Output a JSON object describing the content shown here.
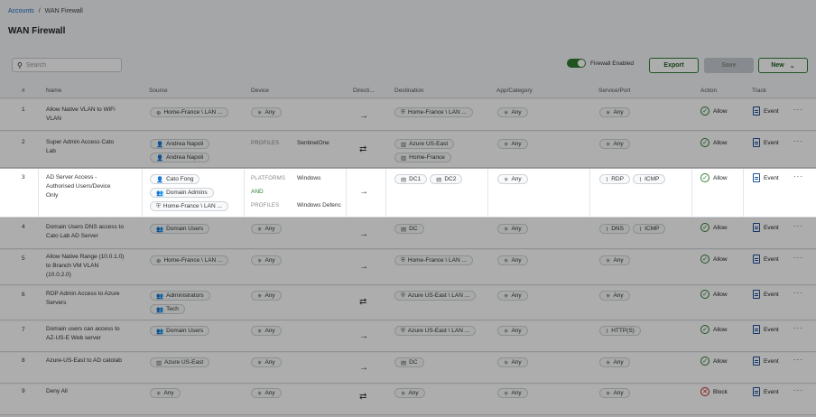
{
  "breadcrumb": {
    "root": "Accounts",
    "sep": "/",
    "current": "WAN Firewall"
  },
  "page_title": "WAN Firewall",
  "search": {
    "placeholder": "Search"
  },
  "toolbar": {
    "firewall_label": "Firewall Enabled",
    "export": "Export",
    "save": "Save",
    "new": "New"
  },
  "columns": [
    "#",
    "Name",
    "Source",
    "Device",
    "Directi...",
    "Destination",
    "App/Category",
    "Service/Port",
    "Action",
    "Track"
  ],
  "rules": [
    {
      "num": "1",
      "name": [
        "Allow Native VLAN to WiFi",
        "VLAN"
      ],
      "source": [
        "Home-France \\ LAN ..."
      ],
      "device": [
        "Any"
      ],
      "direction": "→",
      "destination": [
        "Home-France \\ LAN ..."
      ],
      "app": "Any",
      "service": [
        "Any"
      ],
      "action": "Allow",
      "track": "Event"
    },
    {
      "num": "2",
      "name": [
        "Super Admin Access Cato",
        "Lab"
      ],
      "source": [
        "Andrea Napoli",
        "Andrea Napoli"
      ],
      "device_profiles": "PROFILES",
      "device_value": "SentinelOne",
      "direction": "⇄",
      "destination": [
        "Azure US-East",
        "Home-France"
      ],
      "app": "Any",
      "service": [
        "Any"
      ],
      "action": "Allow",
      "track": "Event"
    },
    {
      "num": "3",
      "name": [
        "AD Server Access -",
        "Authorised Users/Device",
        "Only"
      ],
      "source": [
        "Cato Fong",
        "Domain Admins",
        "Home-France \\ LAN ..."
      ],
      "device_platforms": "PLATFORMS",
      "device_platforms_value": "Windows",
      "device_and": "AND",
      "device_profiles": "PROFILES",
      "device_profiles_value": "Windows Defenc",
      "direction": "→",
      "destination": [
        "DC1",
        "DC2"
      ],
      "app": "Any",
      "service": [
        "RDP",
        "ICMP"
      ],
      "action": "Allow",
      "track": "Event"
    },
    {
      "num": "4",
      "name": [
        "Domain Users DNS access to",
        "Cato Lab AD Server"
      ],
      "source": [
        "Domain Users"
      ],
      "device": [
        "Any"
      ],
      "direction": "→",
      "destination": [
        "DC"
      ],
      "app": "Any",
      "service": [
        "DNS",
        "ICMP"
      ],
      "action": "Allow",
      "track": "Event"
    },
    {
      "num": "5",
      "name": [
        "Allow Native Range (10.0.1.0)",
        "to Branch VM VLAN",
        "(10.0.2.0)"
      ],
      "source": [
        "Home-France \\ LAN ..."
      ],
      "device": [
        "Any"
      ],
      "direction": "→",
      "destination": [
        "Home-France \\ LAN ..."
      ],
      "app": "Any",
      "service": [
        "Any"
      ],
      "action": "Allow",
      "track": "Event"
    },
    {
      "num": "6",
      "name": [
        "RDP Admin Access to Azure",
        "Servers"
      ],
      "source": [
        "Administrators",
        "Tech"
      ],
      "device": [
        "Any"
      ],
      "direction": "⇄",
      "destination": [
        "Azure US-East \\ LAN ..."
      ],
      "app": "Any",
      "service": [
        "Any"
      ],
      "action": "Allow",
      "track": "Event"
    },
    {
      "num": "7",
      "name": [
        "Domain users can access to",
        "AZ-US-E Web server"
      ],
      "source": [
        "Domain Users"
      ],
      "device": [
        "Any"
      ],
      "direction": "→",
      "destination": [
        "Azure US-East \\ LAN ..."
      ],
      "app": "Any",
      "service": [
        "HTTP(S)"
      ],
      "action": "Allow",
      "track": "Event"
    },
    {
      "num": "8",
      "name": [
        "Azure-US-East to AD catolab"
      ],
      "source": [
        "Azure US-East"
      ],
      "device": [
        "Any"
      ],
      "direction": "→",
      "destination": [
        "DC"
      ],
      "app": "Any",
      "service": [
        "Any"
      ],
      "action": "Allow",
      "track": "Event"
    },
    {
      "num": "9",
      "name": [
        "Deny All"
      ],
      "source": [
        "Any"
      ],
      "device": [
        "Any"
      ],
      "direction": "⇄",
      "destination": [
        "Any"
      ],
      "app": "Any",
      "service": [
        "Any"
      ],
      "action": "Block",
      "track": "Event"
    }
  ],
  "colors": {
    "accent": "#2e7d32",
    "link": "#1a66c8",
    "block": "#c62828",
    "overlay": "rgba(0,0,0,0.32)"
  },
  "icons": {
    "search": "search-icon",
    "user": "user-icon",
    "group": "group-icon",
    "site": "site-icon",
    "network": "network-icon",
    "host": "host-icon",
    "any": "asterisk-icon",
    "service": "service-icon",
    "allow": "check-circle-icon",
    "block": "x-circle-icon",
    "track": "document-icon",
    "more": "more-icon"
  }
}
